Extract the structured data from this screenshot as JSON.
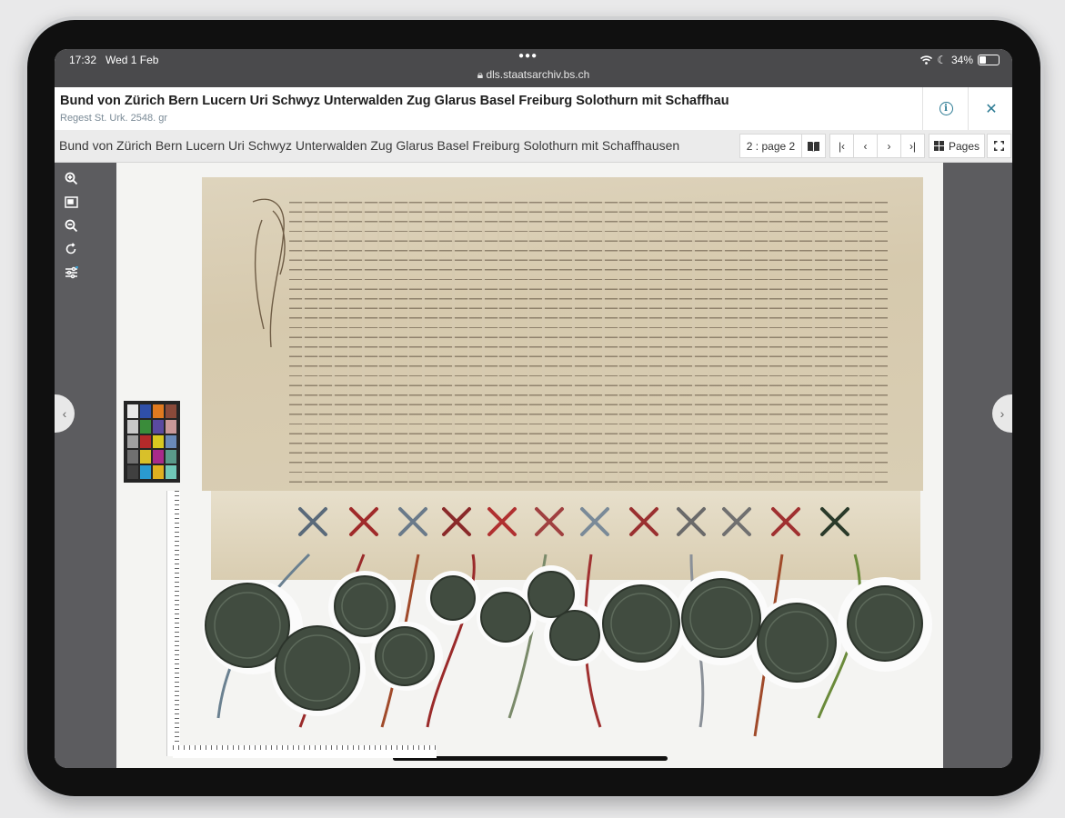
{
  "status_bar": {
    "time": "17:32",
    "date": "Wed 1 Feb",
    "url": "dls.staatsarchiv.bs.ch",
    "battery": "34%",
    "battery_level": 0.34
  },
  "header": {
    "title": "Bund von Zürich Bern Lucern Uri Schwyz Unterwalden Zug Glarus Basel Freiburg Solothurn mit Schaffhausen",
    "subtitle": "Regest St. Urk. 2548. gr"
  },
  "toolbar": {
    "title": "Bund von Zürich Bern Lucern Uri Schwyz Unterwalden Zug Glarus Basel Freiburg Solothurn mit Schaffhausen",
    "page_indicator": "2 : page 2",
    "pages_label": "Pages"
  },
  "icons": {
    "info": "info-icon",
    "close": "close-icon",
    "book": "book-icon",
    "first": "first-page-icon",
    "prev": "previous-page-icon",
    "next": "next-page-icon",
    "last": "last-page-icon",
    "grid": "grid-icon",
    "fullscreen": "fullscreen-icon",
    "zoom_in": "zoom-in-icon",
    "fit": "fit-to-screen-icon",
    "zoom_out": "zoom-out-icon",
    "rotate": "rotate-icon",
    "adjust": "adjust-icon"
  },
  "colors": {
    "accent": "#2b7a93",
    "status_bar": "#4a4a4c",
    "viewer_bg": "#5c5c5f",
    "parchment": "#d9ceb4",
    "seal": "#3f4a3e"
  }
}
